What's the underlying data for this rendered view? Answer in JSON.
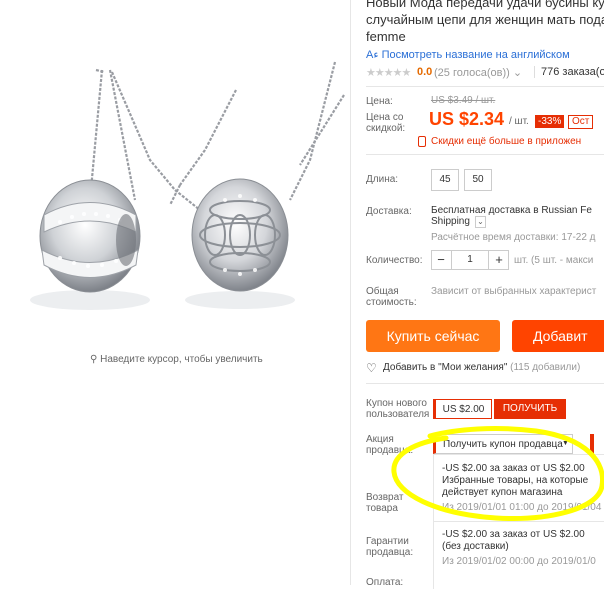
{
  "product": {
    "title_lines": [
      "Новый Мода передачи удачи бусины кул",
      "случайным цепи для женщин мать подар",
      "femme"
    ],
    "translate_link": "Посмотреть название на английском",
    "rating_value": "0.0",
    "votes": "(25 голоса(ов))",
    "orders": "776 заказа(ов"
  },
  "gallery": {
    "zoom_hint": "Наведите курсор, чтобы увеличить"
  },
  "price": {
    "label": "Цена:",
    "old_value": "US $3.49 / шт.",
    "discount_label_1": "Цена со",
    "discount_label_2": "скидкой:",
    "current": "US $2.34",
    "per_unit": "/ шт.",
    "discount_badge": "-33%",
    "tag": "Ост",
    "app_discount": "Скидки ещё больше в приложен"
  },
  "length": {
    "label": "Длина:",
    "options": [
      "45",
      "50"
    ]
  },
  "shipping": {
    "label": "Доставка:",
    "line1": "Бесплатная доставка в Russian Fe",
    "line2": "Shipping",
    "time": "Расчётное время доставки: 17-22 д"
  },
  "quantity": {
    "label": "Количество:",
    "value": "1",
    "minus": "−",
    "plus": "+",
    "note": "шт. (5 шт. - макси"
  },
  "total": {
    "label_1": "Общая",
    "label_2": "стоимость:",
    "note": "Зависит от выбранных характерист"
  },
  "actions": {
    "buy_now": "Купить сейчас",
    "add_to_cart": "Добавит"
  },
  "wishlist": {
    "text": "Добавить в \"Мои желания\"",
    "count": "(115 добавили)"
  },
  "coupon": {
    "label_1": "Купон нового",
    "label_2": "пользователя :",
    "amount": "US $2.00",
    "get": "ПОЛУЧИТЬ"
  },
  "promo": {
    "label_1": "Акция",
    "label_2": "продавца:",
    "dropdown": "Получить купон продавца",
    "items": [
      {
        "line1": "-US $2.00 за заказ от US $2.00",
        "line2": "Избранные товары, на которые",
        "line3": "действует купон магазина",
        "date": "Из 2019/01/01 01:00 до 2019/01/04"
      },
      {
        "line1": "-US $2.00 за заказ от US $2.00",
        "line2": "(без доставки)",
        "date": "Из 2019/01/02 00:00 до 2019/01/0"
      }
    ]
  },
  "returns": {
    "label_1": "Возврат",
    "label_2": "товара"
  },
  "guarantee": {
    "label_1": "Гарантии",
    "label_2": "продавца:"
  },
  "payment": {
    "label": "Оплата:"
  },
  "colors": {
    "price": "#ff4400",
    "buy_now": "#ff7614",
    "add_to_cart": "#ff4400",
    "coupon_red": "#e62e04",
    "highlight": "#ffff00"
  }
}
